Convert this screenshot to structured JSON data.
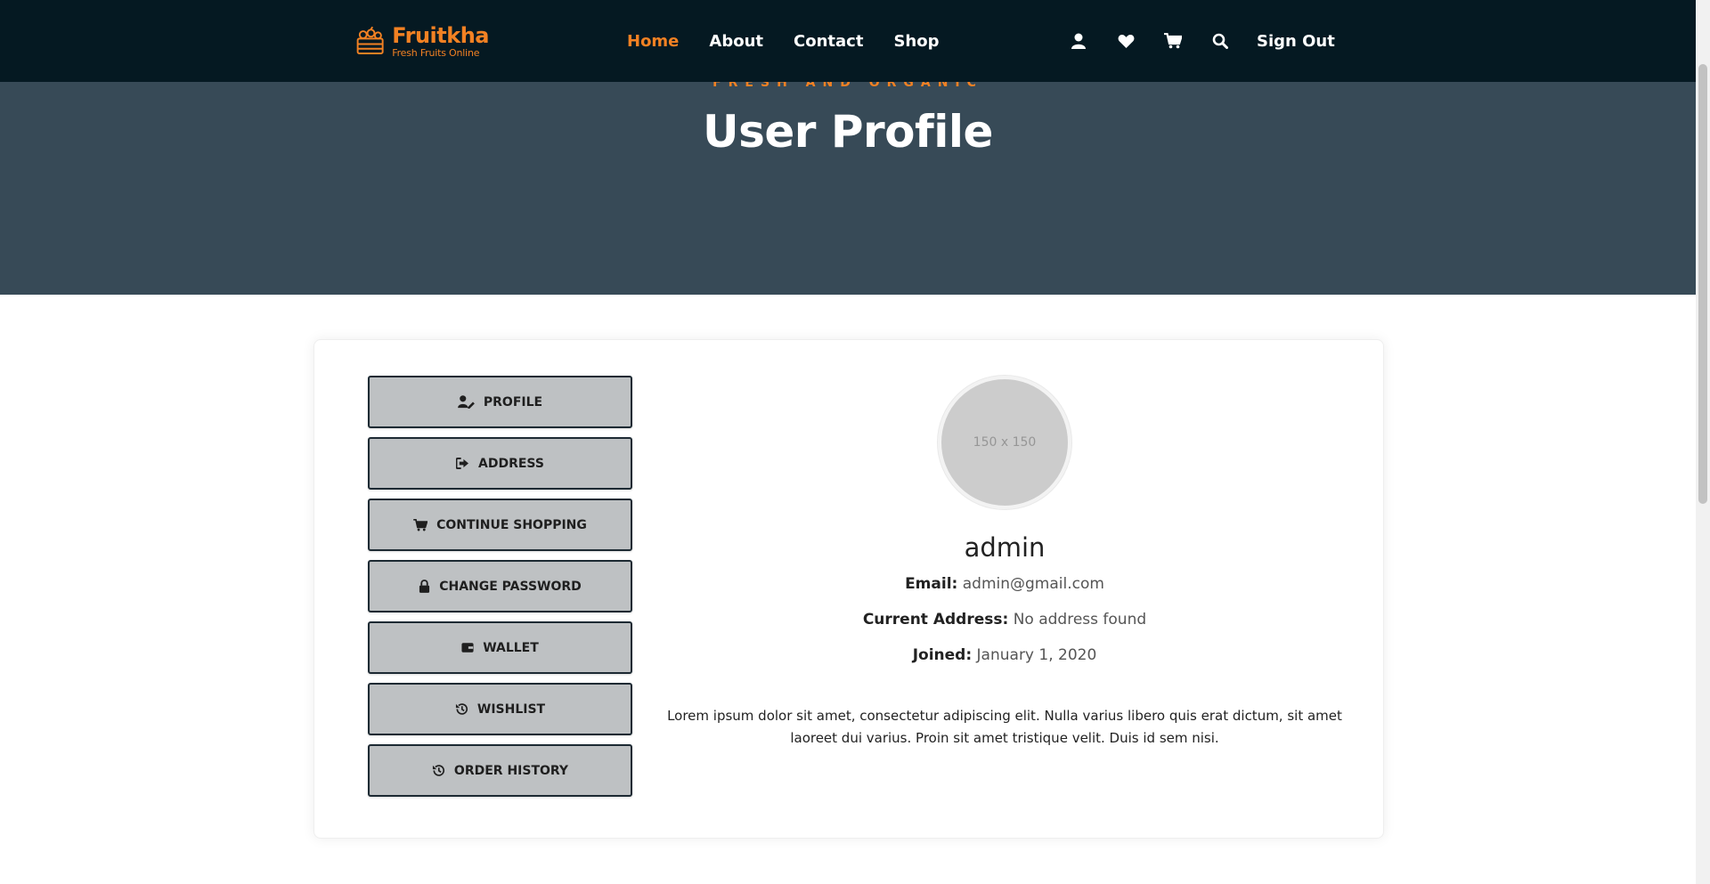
{
  "brand": {
    "title": "Fruitkha",
    "subtitle": "Fresh Fruits Online",
    "accent": "#F28123"
  },
  "nav": {
    "items": [
      "Home",
      "About",
      "Contact",
      "Shop"
    ],
    "active": "Home"
  },
  "header_icons": [
    "user-icon",
    "heart-icon",
    "cart-icon",
    "search-icon"
  ],
  "signout": "Sign Out",
  "hero": {
    "eyebrow": "FRESH AND ORGANIC",
    "title": "User Profile"
  },
  "menu": {
    "items": [
      {
        "label": "PROFILE",
        "icon": "user-edit-icon"
      },
      {
        "label": "ADDRESS",
        "icon": "address-sign-in-icon"
      },
      {
        "label": "CONTINUE SHOPPING",
        "icon": "cart-icon"
      },
      {
        "label": "CHANGE PASSWORD",
        "icon": "lock-icon"
      },
      {
        "label": "WALLET",
        "icon": "wallet-icon"
      },
      {
        "label": "WISHLIST",
        "icon": "history-icon"
      },
      {
        "label": "ORDER HISTORY",
        "icon": "history-icon"
      }
    ]
  },
  "profile": {
    "avatar_placeholder": "150 x 150",
    "username": "admin",
    "email_label": "Email:",
    "email": "admin@gmail.com",
    "address_label": "Current Address:",
    "address": "No address found",
    "joined_label": "Joined:",
    "joined": "January 1, 2020",
    "bio": "Lorem ipsum dolor sit amet, consectetur adipiscing elit. Nulla varius libero quis erat dictum, sit amet laoreet dui varius. Proin sit amet tristique velit. Duis id sem nisi."
  }
}
